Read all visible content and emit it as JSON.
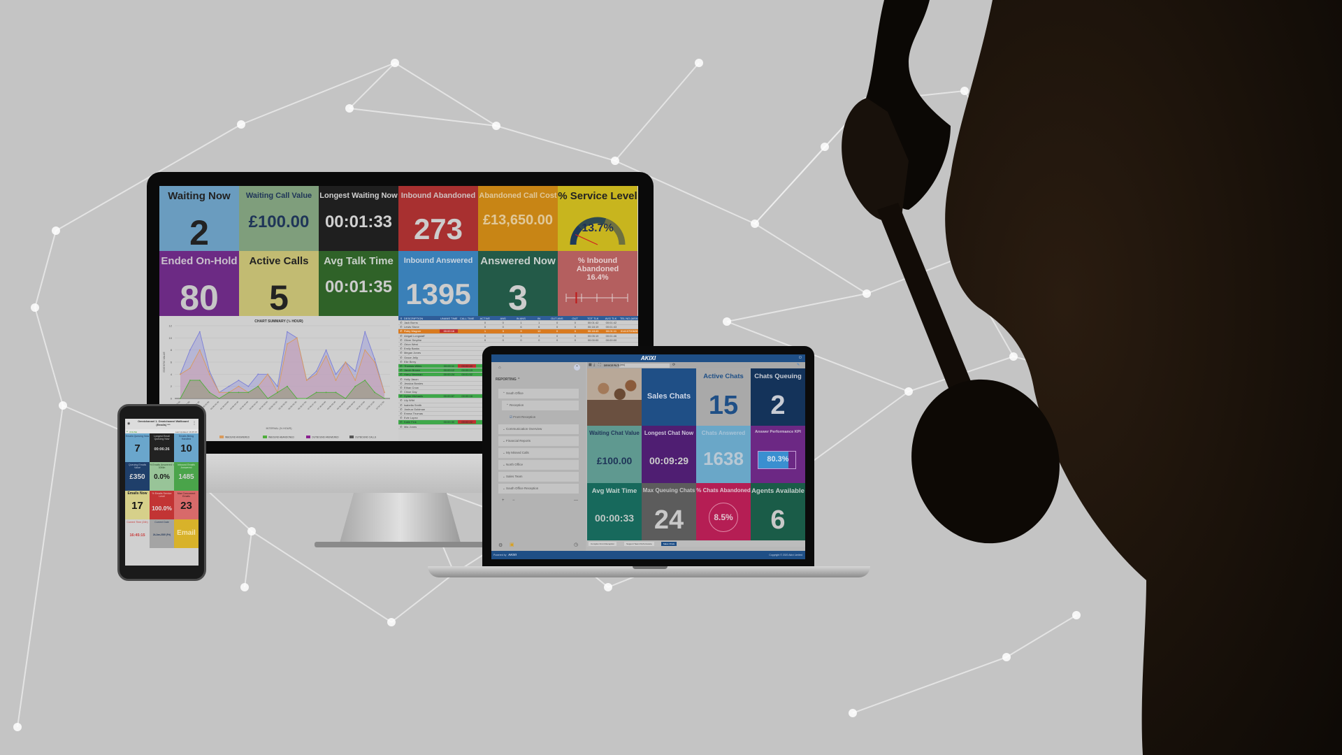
{
  "colors": {
    "background": "#c4c4c4",
    "network_lines": "#f2f2f2",
    "silhouette": "#140e08"
  },
  "monitor": {
    "tiles": [
      {
        "id": "waiting-now",
        "label": "Waiting Now",
        "value": "2",
        "bg": "#6a9cbf",
        "label_color": "#222222",
        "value_color": "#222222",
        "big": true
      },
      {
        "id": "waiting-call-value",
        "label": "Waiting Call Value",
        "value": "£100.00",
        "bg": "#7f9e7c",
        "label_color": "#1f3558",
        "value_color": "#1f3558"
      },
      {
        "id": "longest-waiting-now",
        "label": "Longest Waiting Now",
        "value": "00:01:33",
        "bg": "#1f1f1f",
        "label_color": "#d0d0d0",
        "value_color": "#d0d0d0"
      },
      {
        "id": "inbound-abandoned",
        "label": "Inbound Abandoned",
        "value": "273",
        "bg": "#a83030",
        "label_color": "#d0c0c0",
        "value_color": "#cccccc"
      },
      {
        "id": "abandoned-call-cost",
        "label": "Abandoned Call Cost",
        "value": "£13,650.00",
        "bg": "#c88515",
        "label_color": "#e0c89a",
        "value_color": "#e0c89a"
      },
      {
        "id": "service-level",
        "label": "% Service Level",
        "value": "13.7%",
        "bg": "#c8b51e",
        "label_color": "#222222",
        "value_color": "#1f2f55",
        "big": true
      },
      {
        "id": "ended-on-hold",
        "label": "Ended On-Hold",
        "value": "80",
        "bg": "#6c2a84",
        "label_color": "#c9c0cc",
        "value_color": "#c6c6c6",
        "big": true
      },
      {
        "id": "active-calls",
        "label": "Active Calls",
        "value": "5",
        "bg": "#c2bb72",
        "label_color": "#222222",
        "value_color": "#222222",
        "big": true
      },
      {
        "id": "avg-talk-time",
        "label": "Avg Talk Time",
        "value": "00:01:35",
        "bg": "#2f6228",
        "label_color": "#c8d0c8",
        "value_color": "#cccccc",
        "big": true
      },
      {
        "id": "inbound-answered",
        "label": "Inbound Answered",
        "value": "1395",
        "bg": "#3a80b8",
        "label_color": "#c8d4e0",
        "value_color": "#cccccc"
      },
      {
        "id": "answered-now",
        "label": "Answered Now",
        "value": "3",
        "bg": "#235a48",
        "label_color": "#c8d0cc",
        "value_color": "#cccccc",
        "big": true
      },
      {
        "id": "inbound-abandoned-pct",
        "label": "% Inbound Abandoned",
        "value": "16.4%",
        "bg": "#b45f5f",
        "label_color": "#e6d0d0",
        "value_color": "#e6d0d0"
      }
    ],
    "service_level_gauge_pct": 13.7,
    "abandoned_pct_bullet": 16.4
  },
  "chart_data": {
    "type": "area",
    "title": "CHART SUMMARY (½ HOUR)",
    "xlabel": "INTERVAL (½ HOUR)",
    "ylabel": "STATISTIC VALUE",
    "ylim": [
      0,
      12
    ],
    "yticks": [
      0,
      2,
      4,
      6,
      8,
      10,
      12
    ],
    "grid": true,
    "legend_position": "bottom",
    "x": [
      "00:00-00:30",
      "00:30-01:00",
      "01:00-01:30",
      "01:30-02:00",
      "02:00-02:30",
      "02:30-03:00",
      "03:00-03:30",
      "03:30-04:00",
      "04:00-04:30",
      "04:30-05:00",
      "05:00-05:30",
      "05:30-06:00",
      "06:00-06:30",
      "06:30-07:00",
      "07:00-07:30",
      "07:30-08:00",
      "08:00-08:30",
      "08:30-09:00",
      "09:00-09:30",
      "09:30-10:00",
      "10:00-10:30",
      "10:30-11:00",
      "11:00-11:30"
    ],
    "series": [
      {
        "name": "INBOUND CALLS",
        "color": "#7b7fd6",
        "values": [
          4,
          8,
          11,
          4.5,
          1,
          2,
          3,
          2,
          4,
          4,
          2,
          11,
          10,
          3,
          4.5,
          8,
          4,
          6,
          4.5,
          11,
          6.5,
          1
        ]
      },
      {
        "name": "INBOUND ANSWERED",
        "color": "#d99a5b",
        "values": [
          4,
          5,
          8,
          4,
          1,
          1,
          2,
          1,
          2,
          4,
          1,
          9,
          10,
          3,
          4,
          7,
          3,
          6,
          3,
          8,
          6,
          1
        ]
      },
      {
        "name": "INBOUND ABANDONED",
        "color": "#4fae3c",
        "values": [
          0,
          3,
          3,
          1,
          0,
          1,
          1,
          1,
          2,
          0,
          1,
          2,
          0,
          0,
          1,
          1,
          1,
          0,
          2,
          3,
          1,
          0
        ]
      },
      {
        "name": "OUTBOUND ANSWERED",
        "color": "#8a1f8f",
        "values": []
      },
      {
        "name": "OUTBOUND CALLS",
        "color": "#555555",
        "values": []
      }
    ]
  },
  "agent_table": {
    "columns": [
      "S",
      "DESCRIPTION",
      "UNANS TIME",
      "CALL TIME",
      "ACTIVE",
      "ANS",
      "IN ANS",
      "IN",
      "OUT ANS",
      "OUT",
      "TOT TLK",
      "AVG TLK",
      "TEL NO (MSN)"
    ],
    "rows": [
      {
        "name": "Jack Burns",
        "style": "",
        "cells": [
          "",
          "",
          "0",
          "0",
          "1",
          "1",
          "0",
          "0",
          "00:01:42",
          "00:01:42",
          ""
        ]
      },
      {
        "name": "Lewis Stone",
        "style": "",
        "cells": [
          "",
          "",
          "0",
          "0",
          "6",
          "6",
          "0",
          "0",
          "00:18:19",
          "00:01:43",
          ""
        ]
      },
      {
        "name": "Ruby Wagner",
        "style": "orange",
        "cells": [
          "00:00:16",
          "",
          "1",
          "3",
          "9",
          "12",
          "0",
          "0",
          "00:18:43",
          "00:01:11",
          "01410700628"
        ]
      },
      {
        "name": "Abigail Longstaff",
        "style": "",
        "cells": [
          "",
          "",
          "0",
          "0",
          "3",
          "3",
          "0",
          "0",
          "00:05:19",
          "00:01:46",
          ""
        ]
      },
      {
        "name": "Oliver Smythe",
        "style": "",
        "cells": [
          "",
          "",
          "0",
          "0",
          "0",
          "0",
          "0",
          "0",
          "00:00:00",
          "00:00:00",
          ""
        ]
      },
      {
        "name": "Orion West",
        "style": "",
        "cells": [
          "",
          "",
          "",
          "",
          "",
          "",
          "",
          "",
          "",
          "",
          ""
        ]
      },
      {
        "name": "Emily Banks",
        "style": "",
        "cells": [
          "",
          "",
          "",
          "",
          "",
          "",
          "",
          "",
          "",
          "",
          ""
        ]
      },
      {
        "name": "Megan Jones",
        "style": "",
        "cells": [
          "",
          "",
          "",
          "",
          "",
          "",
          "",
          "",
          "",
          "",
          ""
        ]
      },
      {
        "name": "Grace Jelly",
        "style": "",
        "cells": [
          "",
          "",
          "",
          "",
          "",
          "",
          "",
          "",
          "",
          "",
          ""
        ]
      },
      {
        "name": "Elle Berry",
        "style": "",
        "cells": [
          "",
          "",
          "",
          "",
          "",
          "",
          "",
          "",
          "",
          "",
          ""
        ]
      },
      {
        "name": "Thomas Wiles",
        "style": "green",
        "cells": [
          "00:00:11",
          "00:02:40",
          "",
          "",
          "",
          "",
          "",
          "",
          "",
          "",
          ""
        ]
      },
      {
        "name": "Jacob Brown",
        "style": "green",
        "cells": [
          "00:00:12",
          "00:00:19",
          "",
          "",
          "",
          "",
          "",
          "",
          "",
          "",
          ""
        ]
      },
      {
        "name": "Harry Newman",
        "style": "green",
        "cells": [
          "00:00:24",
          "00:01:52",
          "",
          "",
          "",
          "",
          "",
          "",
          "",
          "",
          ""
        ]
      },
      {
        "name": "Holly Jason",
        "style": "",
        "cells": [
          "",
          "",
          "",
          "",
          "",
          "",
          "",
          "",
          "",
          "",
          ""
        ]
      },
      {
        "name": "Jessica Bowles",
        "style": "",
        "cells": [
          "",
          "",
          "",
          "",
          "",
          "",
          "",
          "",
          "",
          "",
          ""
        ]
      },
      {
        "name": "Ethan Crow",
        "style": "",
        "cells": [
          "",
          "",
          "",
          "",
          "",
          "",
          "",
          "",
          "",
          "",
          ""
        ]
      },
      {
        "name": "Chloe Day",
        "style": "",
        "cells": [
          "",
          "",
          "",
          "",
          "",
          "",
          "",
          "",
          "",
          "",
          ""
        ]
      },
      {
        "name": "Dylan Michaels",
        "style": "green",
        "cells": [
          "00:00:57",
          "00:00:16",
          "",
          "",
          "",
          "",
          "",
          "",
          "",
          "",
          ""
        ]
      },
      {
        "name": "Lily Wild",
        "style": "",
        "cells": [
          "",
          "",
          "",
          "",
          "",
          "",
          "",
          "",
          "",
          "",
          ""
        ]
      },
      {
        "name": "Isabella Smith",
        "style": "",
        "cells": [
          "",
          "",
          "",
          "",
          "",
          "",
          "",
          "",
          "",
          "",
          ""
        ]
      },
      {
        "name": "Joshua Goldman",
        "style": "",
        "cells": [
          "",
          "",
          "",
          "",
          "",
          "",
          "",
          "",
          "",
          "",
          ""
        ]
      },
      {
        "name": "Emma Thomas",
        "style": "",
        "cells": [
          "",
          "",
          "",
          "",
          "",
          "",
          "",
          "",
          "",
          "",
          ""
        ]
      },
      {
        "name": "Evie Lopez",
        "style": "",
        "cells": [
          "",
          "",
          "",
          "",
          "",
          "",
          "",
          "",
          "",
          "",
          ""
        ]
      },
      {
        "name": "Katie Fink",
        "style": "green",
        "cells": [
          "00:00:30",
          "00:02:22",
          "",
          "",
          "",
          "",
          "",
          "",
          "",
          "",
          ""
        ]
      },
      {
        "name": "Mia Jones",
        "style": "",
        "cells": [
          "",
          "",
          "",
          "",
          "",
          "",
          "",
          "",
          "",
          "",
          ""
        ]
      }
    ]
  },
  "laptop": {
    "brand": "AKIXI",
    "device_filter_label": "DEVICE FILTER:",
    "device_filter_value": "(ms)",
    "sidebar": {
      "section": "REPORTING",
      "items": [
        {
          "label": "South Office",
          "level": 0,
          "expanded": true
        },
        {
          "label": "Reception",
          "level": 1,
          "expanded": true
        },
        {
          "label": "Front Reception",
          "level": 2,
          "checked": true
        },
        {
          "label": "Communication Overview",
          "level": 0
        },
        {
          "label": "Financial Reports",
          "level": 0
        },
        {
          "label": "My Missed Calls",
          "level": 0
        },
        {
          "label": "North Office",
          "level": 0
        },
        {
          "label": "Sales Team",
          "level": 0
        },
        {
          "label": "South Office Reception",
          "level": 0
        }
      ],
      "add_label": "+",
      "remove_label": "−",
      "collapse_label": "—"
    },
    "tiles": [
      {
        "id": "sales-chats",
        "label": "Sales Chats",
        "value": "",
        "bg": "#1f4f86",
        "label_color": "#d0d8e8"
      },
      {
        "id": "active-chats",
        "label": "Active Chats",
        "value": "15",
        "bg": "#a9a9a9",
        "label_color": "#1f4f86",
        "value_color": "#1f4f86"
      },
      {
        "id": "chats-queuing",
        "label": "Chats Queuing",
        "value": "2",
        "bg": "#14335a",
        "label_color": "#c8ccd4",
        "value_color": "#c8ccd4"
      },
      {
        "id": "waiting-chat-value",
        "label": "Waiting Chat Value",
        "value": "£100.00",
        "bg": "#5f9990",
        "label_color": "#1f3558",
        "value_color": "#1f3558"
      },
      {
        "id": "longest-chat-now",
        "label": "Longest Chat Now",
        "value": "00:09:29",
        "bg": "#4f1e72",
        "label_color": "#d0c8dc",
        "value_color": "#cccccc"
      },
      {
        "id": "chats-answered",
        "label": "Chats Answered",
        "value": "1638",
        "bg": "#6aa7c8",
        "label_color": "#a8c4d8",
        "value_color": "#b8c8d4"
      },
      {
        "id": "answer-performance-kpi",
        "label": "Answer Performance KPI",
        "value": "80.3%",
        "bg": "#6c2884",
        "label_color": "#d0c4d8",
        "value_color": "#d8e4f0"
      },
      {
        "id": "avg-wait-time",
        "label": "Avg Wait Time",
        "value": "00:00:33",
        "bg": "#17695c",
        "label_color": "#c4d4d0",
        "value_color": "#c0c8c6"
      },
      {
        "id": "max-queuing-chats",
        "label": "Max Queuing Chats",
        "value": "24",
        "bg": "#5c5c5c",
        "label_color": "#c4c4c4",
        "value_color": "#c8c8c8"
      },
      {
        "id": "chats-abandoned-pct",
        "label": "% Chats Abandoned",
        "value": "8.5%",
        "bg": "#b51e54",
        "label_color": "#e0c4d0",
        "value_color": "#e0c8d0"
      },
      {
        "id": "agents-available",
        "label": "Agents Available",
        "value": "6",
        "bg": "#1a5c48",
        "label_color": "#c4d0cc",
        "value_color": "#c8c8c8"
      }
    ],
    "answer_performance_pct": 80.3,
    "tabs": [
      {
        "label": "Complex Front Reception",
        "active": false
      },
      {
        "label": "Support Team Performance",
        "active": false
      },
      {
        "label": "Sales Chats",
        "active": true
      }
    ],
    "footer_left": "Powered by",
    "footer_brand": "AKIXI",
    "footer_right": "Copyright © 2020 Akixi Limited"
  },
  "phone": {
    "title": "Omnichannel 1. Omnichannel Wallboard (Emails) ***",
    "status": "ONLINE",
    "last_updated": "Last Updated: 16:45:15",
    "tiles": [
      {
        "id": "emails-queuing-now",
        "label": "Emails Queuing Now",
        "value": "7",
        "bg": "#6aa6cc",
        "label_color": "#1f3558",
        "value_color": "#1a1a1a"
      },
      {
        "id": "longest-email-queuing-now",
        "label": "Longest Email Queuing Now",
        "value": "00:06:26",
        "bg": "#222222",
        "label_color": "#cccccc",
        "value_color": "#dddddd"
      },
      {
        "id": "emails-being-handled",
        "label": "Emails Being Handled",
        "value": "10",
        "bg": "#6aa6cc",
        "label_color": "#1f3558",
        "value_color": "#1a1a1a"
      },
      {
        "id": "queuing-emails-value",
        "label": "Queuing Emails Value",
        "value": "£350",
        "bg": "#1f3f6a",
        "label_color": "#b8c4d8",
        "value_color": "#dddddd"
      },
      {
        "id": "emails-answered-pct",
        "label": "% Emails Answered < 30Min",
        "value": "0.0%",
        "bg": "#98c498",
        "label_color": "#2a4a2a",
        "value_color": "#1a1a1a"
      },
      {
        "id": "inbound-emails-answered",
        "label": "Inbound Emails Answered",
        "value": "1485",
        "bg": "#4aa44a",
        "label_color": "#cfe8cf",
        "value_color": "#d4d4d4"
      },
      {
        "id": "emails-now",
        "label": "Emails Now",
        "value": "17",
        "bg": "#d6d08a",
        "label_color": "#222222",
        "value_color": "#111111"
      },
      {
        "id": "emails-service-level",
        "label": "% Emails Service Level",
        "value": "100.0%",
        "bg": "#c23434",
        "label_color": "#f0c8c8",
        "value_color": "#e0e0e0"
      },
      {
        "id": "max-concurrent-emails",
        "label": "Max Concurrent Emails",
        "value": "23",
        "bg": "#d86a6a",
        "label_color": "#3a1a1a",
        "value_color": "#1a1a1a"
      },
      {
        "id": "current-time",
        "label": "Current Time (24h)",
        "value": "16:45:15",
        "bg": "#d0d0d0",
        "label_color": "#c83a3a",
        "value_color": "#c83a3a"
      },
      {
        "id": "current-date",
        "label": "Current Date",
        "value": "24-Jan-2020 (Fri)",
        "bg": "#a4a4a4",
        "label_color": "#1f3558",
        "value_color": "#1f3558"
      },
      {
        "id": "email-label",
        "label": "",
        "value": "Email",
        "bg": "#d8b22a",
        "label_color": "#222222",
        "value_color": "#f4e4b0"
      }
    ]
  }
}
